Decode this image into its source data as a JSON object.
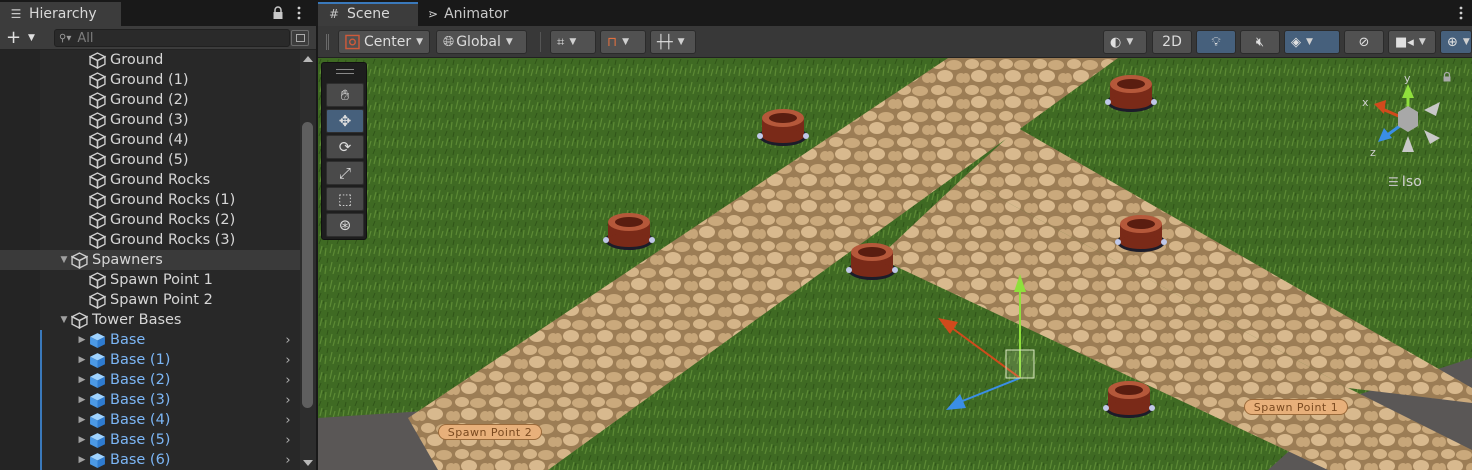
{
  "hierarchy": {
    "tab_title": "Hierarchy",
    "search_placeholder": "All",
    "plus_label": "+",
    "rows": [
      {
        "label": "Ground",
        "depth": 2,
        "type": "object"
      },
      {
        "label": "Ground (1)",
        "depth": 2,
        "type": "object"
      },
      {
        "label": "Ground (2)",
        "depth": 2,
        "type": "object"
      },
      {
        "label": "Ground (3)",
        "depth": 2,
        "type": "object"
      },
      {
        "label": "Ground (4)",
        "depth": 2,
        "type": "object"
      },
      {
        "label": "Ground (5)",
        "depth": 2,
        "type": "object"
      },
      {
        "label": "Ground Rocks",
        "depth": 2,
        "type": "object"
      },
      {
        "label": "Ground Rocks (1)",
        "depth": 2,
        "type": "object"
      },
      {
        "label": "Ground Rocks (2)",
        "depth": 2,
        "type": "object"
      },
      {
        "label": "Ground Rocks (3)",
        "depth": 2,
        "type": "object"
      },
      {
        "label": "Spawners",
        "depth": 1,
        "type": "object",
        "expanded": true,
        "selected": true
      },
      {
        "label": "Spawn Point 1",
        "depth": 2,
        "type": "object"
      },
      {
        "label": "Spawn Point 2",
        "depth": 2,
        "type": "object"
      },
      {
        "label": "Tower Bases",
        "depth": 1,
        "type": "object",
        "expanded": true
      },
      {
        "label": "Base",
        "depth": 2,
        "type": "prefab"
      },
      {
        "label": "Base (1)",
        "depth": 2,
        "type": "prefab"
      },
      {
        "label": "Base (2)",
        "depth": 2,
        "type": "prefab"
      },
      {
        "label": "Base (3)",
        "depth": 2,
        "type": "prefab"
      },
      {
        "label": "Base (4)",
        "depth": 2,
        "type": "prefab"
      },
      {
        "label": "Base (5)",
        "depth": 2,
        "type": "prefab"
      },
      {
        "label": "Base (6)",
        "depth": 2,
        "type": "prefab"
      }
    ]
  },
  "tabs": {
    "scene": "Scene",
    "animator": "Animator"
  },
  "scene_toolbar": {
    "pivot_mode": "Center",
    "pivot_rotation": "Global",
    "view_2d": "2D"
  },
  "viewport": {
    "projection_label": "Iso",
    "gizmo_axes": {
      "x": "x",
      "y": "y",
      "z": "z"
    },
    "spawn_labels": [
      "Spawn Point 2",
      "Spawn Point 1"
    ]
  },
  "colors": {
    "accent": "#3a79bb",
    "prefab_text": "#7cb6f5",
    "grass": "#3f6a23",
    "path": "#c8a878"
  },
  "icons": {
    "hierarchy_tab": "list-icon",
    "scene_tab": "grid-icon",
    "animator_tab": "animator-icon",
    "lock": "lock-icon",
    "menu": "kebab-menu-icon",
    "object": "cube-icon",
    "prefab": "prefab-cube-icon"
  }
}
